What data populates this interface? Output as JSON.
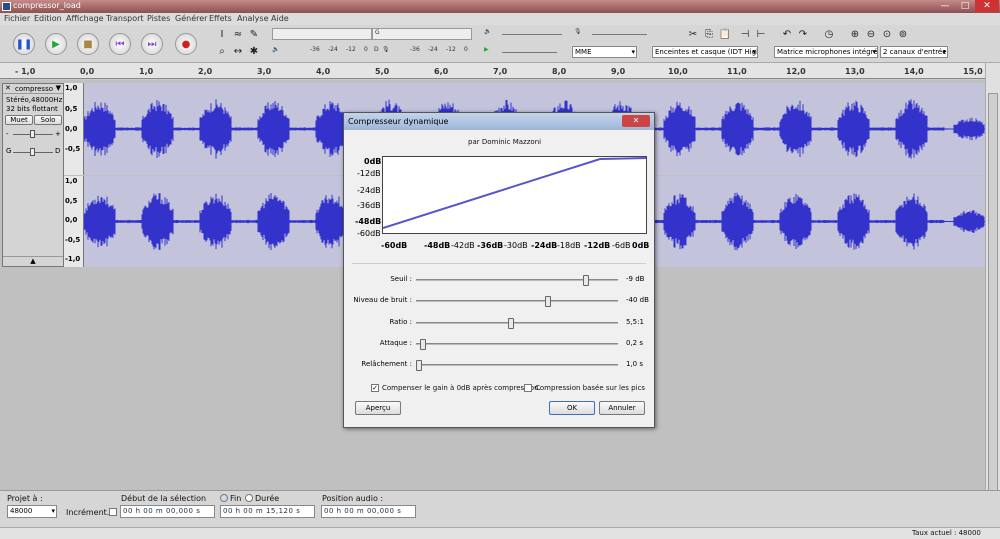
{
  "window": {
    "title": "compressor_load"
  },
  "menu": [
    "Fichier",
    "Edition",
    "Affichage",
    "Transport",
    "Pistes",
    "Générer",
    "Effets",
    "Analyse",
    "Aide"
  ],
  "meters": {
    "ticks": [
      "-36",
      "-24",
      "-12",
      "0"
    ],
    "rec_ticks": [
      "-36",
      "-24",
      "-12",
      "0"
    ],
    "left_label": "G",
    "right_label": "D"
  },
  "devices": {
    "host": "MME",
    "output": "Enceintes et casque (IDT High",
    "input": "Matrice microphones intégrée",
    "channels": "2 canaux d'entrée"
  },
  "ruler": {
    "ticks": [
      "- 1,0",
      "0,0",
      "1,0",
      "2,0",
      "3,0",
      "4,0",
      "5,0",
      "6,0",
      "7,0",
      "8,0",
      "9,0",
      "10,0",
      "11,0",
      "12,0",
      "13,0",
      "14,0",
      "15,0"
    ]
  },
  "track": {
    "name": "compresso",
    "info1": "Stéréo,48000Hz",
    "info2": "32 bits flottant",
    "mute": "Muet",
    "solo": "Solo",
    "gain_left": "-",
    "gain_right": "+",
    "pan_left": "G",
    "pan_right": "D",
    "vruler_top": [
      "1,0",
      "0,5",
      "0,0",
      "-0,5"
    ],
    "vruler_bottom": [
      "1,0",
      "0,5",
      "0,0",
      "-0,5",
      "-1,0"
    ]
  },
  "dialog": {
    "title": "Compresseur dynamique",
    "author": "par Dominic Mazzoni",
    "close": "✕",
    "graph_y": [
      "0dB",
      "-12dB",
      "-24dB",
      "-36dB",
      "-48dB",
      "-60dB"
    ],
    "graph_x": [
      "-60dB",
      "-48dB",
      "-42dB",
      "-36dB",
      "-30dB",
      "-24dB",
      "-18dB",
      "-12dB",
      "-6dB",
      "0dB"
    ],
    "sliders": [
      {
        "label": "Seuil :",
        "value": "-9 dB",
        "level": 0.85
      },
      {
        "label": "Niveau de bruit :",
        "value": "-40 dB",
        "level": 0.66
      },
      {
        "label": "Ratio :",
        "value": "5,5:1",
        "level": 0.47
      },
      {
        "label": "Attaque :",
        "value": "0,2 s",
        "level": 0.02
      },
      {
        "label": "Relâchement :",
        "value": "1,0 s",
        "level": 0.0
      }
    ],
    "check_gain": "Compenser le gain à 0dB après compression.",
    "check_gain_state": true,
    "check_peak": "Compression basée sur les pics",
    "check_peak_state": false,
    "preview": "Aperçu",
    "ok": "OK",
    "cancel": "Annuler"
  },
  "bottom": {
    "rate_label": "Projet à :",
    "rate_value": "48000",
    "snap_label": "Incrément...",
    "selection_label": "Début de la sélection",
    "end_label": "Fin",
    "duration_label": "Durée",
    "start_time": "00 h 00 m 00,000 s",
    "end_time": "00 h 00 m 15,120 s",
    "audio_pos_label": "Position audio :",
    "audio_pos": "00 h 00 m 00,000 s"
  },
  "status": {
    "rate": "Taux actuel : 48000"
  },
  "colors": {
    "wave": "#3333cc",
    "wave_bg": "#c3c3dc",
    "curve": "#5555cc"
  }
}
